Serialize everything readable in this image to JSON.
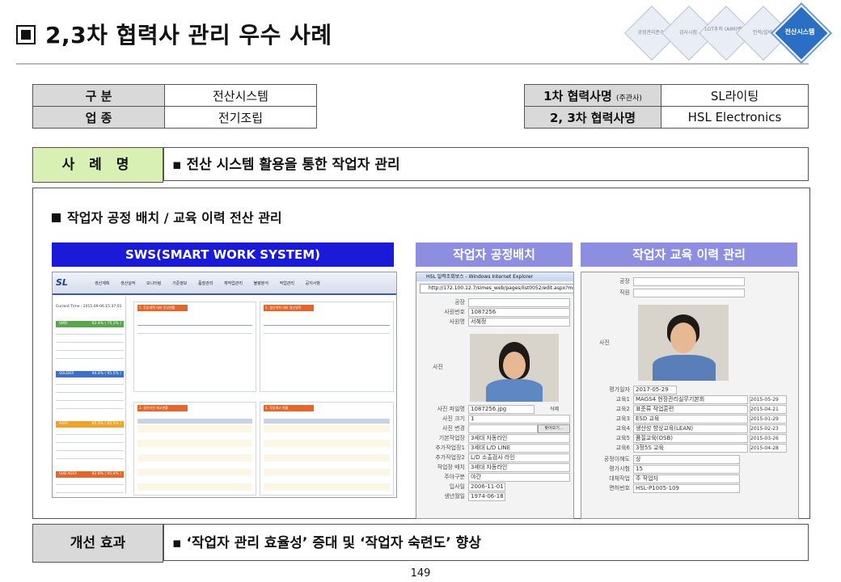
{
  "title": "2,3차 협력사 관리 우수 사례",
  "process_steps": [
    {
      "label": "공정관리준수",
      "active": false
    },
    {
      "label": "검사시점",
      "active": false
    },
    {
      "label": "LOT추적 (AIM)변경",
      "active": false
    },
    {
      "label": "인력/설비",
      "active": false
    },
    {
      "label": "전산시스템",
      "active": true
    }
  ],
  "info": {
    "category_label": "구  분",
    "category_value": "전산시스템",
    "industry_label": "업  종",
    "industry_value": "전기조립",
    "tier1_label": "1차 협력사명",
    "tier1_note": "(주관사)",
    "tier1_value": "SL라이팅",
    "tier23_label": "2, 3차 협력사명",
    "tier23_value": "HSL Electronics"
  },
  "case": {
    "label": "사 례 명",
    "value": "▪ 전산 시스템 활용을 통한 작업자 관리"
  },
  "section": {
    "subtitle": "작업자 공정 배치 / 교육 이력 전산 관리",
    "panels": [
      {
        "header": "SWS(SMART WORK SYSTEM)"
      },
      {
        "header": "작업자 공정배치"
      },
      {
        "header": "작업자 교육 이력 관리"
      }
    ]
  },
  "sws": {
    "logo": "SL",
    "menu": [
      "생산계획",
      "생산실적",
      "모니터링",
      "기준정보",
      "품질관리",
      "재작업관리",
      "불량분석",
      "작업관리",
      "공지사항"
    ],
    "lines": [
      "SMD",
      "SOLDER",
      "ASSY",
      "SUB ASSY"
    ],
    "rates": [
      "62.4% ( 75.1% )",
      "94.4% ( 95.5% )",
      "85.5% ( 85.5% )",
      "82.8% ( 95.4% )"
    ],
    "current_time": "Current Time : 2015-09-06 15:37:01",
    "panel_titles": [
      "1. 투입계획 대비 투입현황",
      "2. 생산계획 대비 생산실적",
      "3. 생산라인 재고현황",
      "4. 작업재고 현황"
    ]
  },
  "placement": {
    "window_title": "HSL 일력조회보스 - Windows Internet Explorer",
    "url": "http://172.100.12.7/simes_web/pages/list0052/edit.aspx?mnu_si",
    "fields": [
      {
        "k": "공장",
        "v": ""
      },
      {
        "k": "사원번호",
        "v": "1087256"
      },
      {
        "k": "사원명",
        "v": "서혜정"
      }
    ],
    "photo_label": "사진",
    "bottom_fields": [
      {
        "k": "사진 파일명",
        "v": "1087256.jpg"
      },
      {
        "k": "사진 크기",
        "v": "1"
      },
      {
        "k": "사진 변경",
        "v": ""
      },
      {
        "k": "기본작업장",
        "v": "3세대 자동라인"
      },
      {
        "k": "추가작업장1",
        "v": "3세대 L/D LINE"
      },
      {
        "k": "추가작업장2",
        "v": "L/D 소출검사 라인"
      },
      {
        "k": "작업장 배치",
        "v": "3세대 자동라인"
      },
      {
        "k": "주야구분",
        "v": "야간"
      },
      {
        "k": "입사일",
        "v": "2006-11-01"
      },
      {
        "k": "생년월일",
        "v": "1974-06-18"
      }
    ],
    "delete_label": "삭제",
    "browse_label": "찾아보기..."
  },
  "training": {
    "fields": [
      {
        "k": "공장",
        "v": ""
      },
      {
        "k": "직원",
        "v": ""
      }
    ],
    "photo_label": "사진",
    "eval_date_label": "평가일자",
    "eval_date": "2017-05-29",
    "courses": [
      {
        "k": "교육1",
        "v": "MAGS4 현장관리실무기본회",
        "d": "2015-05-29"
      },
      {
        "k": "교육2",
        "v": "표준류 작업훈련",
        "d": "2015-04-21"
      },
      {
        "k": "교육3",
        "v": "ESD 교육",
        "d": "2015-01-29"
      },
      {
        "k": "교육4",
        "v": "생산성 향상교육(LEAN)",
        "d": "2015-02-23"
      },
      {
        "k": "교육5",
        "v": "품질교육(OSB)",
        "d": "2015-03-26"
      },
      {
        "k": "교육6",
        "v": "3정5S 교육",
        "d": "2015-04-28"
      }
    ],
    "tail": [
      {
        "k": "공정이해도",
        "v": "상"
      },
      {
        "k": "평가시험",
        "v": "15"
      },
      {
        "k": "대체작업",
        "v": "주 작업자"
      },
      {
        "k": "면허번호",
        "v": "HSL-P1005-109"
      }
    ]
  },
  "effect": {
    "label": "개선 효과",
    "value": "▪ ‘작업자 관리 효율성’ 증대 및 ‘작업자 숙련도’ 향상"
  },
  "page_number": "149",
  "colors": {
    "case_label_bg": "#d9f0b4",
    "sws_header": "#1a1ad8",
    "panel_header": "#8e8ee0",
    "active_step": "#2b6fc4"
  }
}
